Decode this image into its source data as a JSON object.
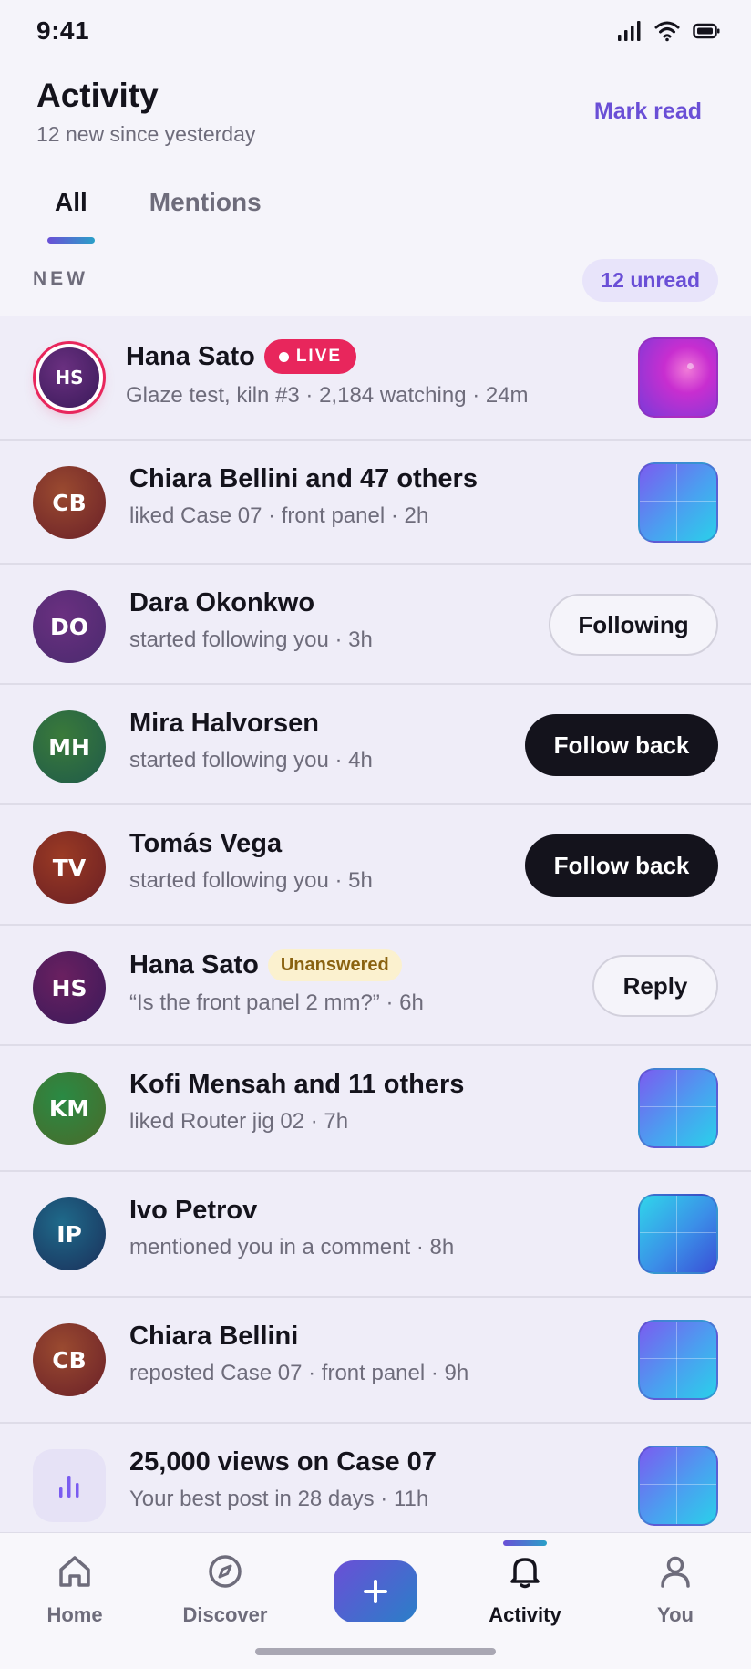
{
  "status_bar": {
    "time": "9:41"
  },
  "header": {
    "title": "Activity",
    "subtitle": "12 new since yesterday",
    "mark_read": "Mark read"
  },
  "tabs": [
    {
      "label": "All",
      "active": true
    },
    {
      "label": "Mentions",
      "active": false
    }
  ],
  "section": {
    "label": "NEW",
    "unread": "12 unread"
  },
  "feed": [
    {
      "initials": "HS",
      "name": "Hana Sato",
      "badge": "LIVE",
      "sub": "Glaze test, kiln #3 · 2,184 watching · 24m",
      "trailing": "thumb-pink"
    },
    {
      "initials": "CB",
      "name": "Chiara Bellini and 47 others",
      "sub": "liked Case 07 · front panel · 2h",
      "trailing": "thumb-blue"
    },
    {
      "initials": "DO",
      "name": "Dara Okonkwo",
      "sub": "started following you · 3h",
      "button": "Following"
    },
    {
      "initials": "MH",
      "name": "Mira Halvorsen",
      "sub": "started following you · 4h",
      "button": "Follow back"
    },
    {
      "initials": "TV",
      "name": "Tomás Vega",
      "sub": "started following you · 5h",
      "button": "Follow back"
    },
    {
      "initials": "HS",
      "name": "Hana Sato",
      "badge": "Unanswered",
      "sub": "“Is the front panel 2 mm?” · 6h",
      "button": "Reply"
    },
    {
      "initials": "KM",
      "name": "Kofi Mensah and 11 others",
      "sub": "liked Router jig 02 · 7h",
      "trailing": "thumb-blue"
    },
    {
      "initials": "IP",
      "name": "Ivo Petrov",
      "sub": "mentioned you in a comment · 8h",
      "trailing": "thumb-cyan"
    },
    {
      "initials": "CB",
      "name": "Chiara Bellini",
      "sub": "reposted Case 07 · front panel · 9h",
      "trailing": "thumb-blue"
    },
    {
      "icon": "bar-chart-icon",
      "name": "25,000 views on Case 07",
      "sub": "Your best post in 28 days · 11h",
      "trailing": "thumb-blue"
    }
  ],
  "avatar_colors": {
    "HS": "#5a2060",
    "CB": "#8a3a2a",
    "DO": "#5a2a6e",
    "MH": "#2f6a3a",
    "TV": "#8a2e24",
    "KM": "#2a7a44",
    "IP": "#1f4f7a"
  },
  "accent_color": "#6a4fd6",
  "live_color": "#e8265c",
  "nav": [
    {
      "label": "Home",
      "icon": "home-icon"
    },
    {
      "label": "Discover",
      "icon": "compass-icon"
    },
    {
      "label": "",
      "icon": "plus-icon"
    },
    {
      "label": "Activity",
      "icon": "bell-icon",
      "active": true
    },
    {
      "label": "You",
      "icon": "person-icon"
    }
  ]
}
